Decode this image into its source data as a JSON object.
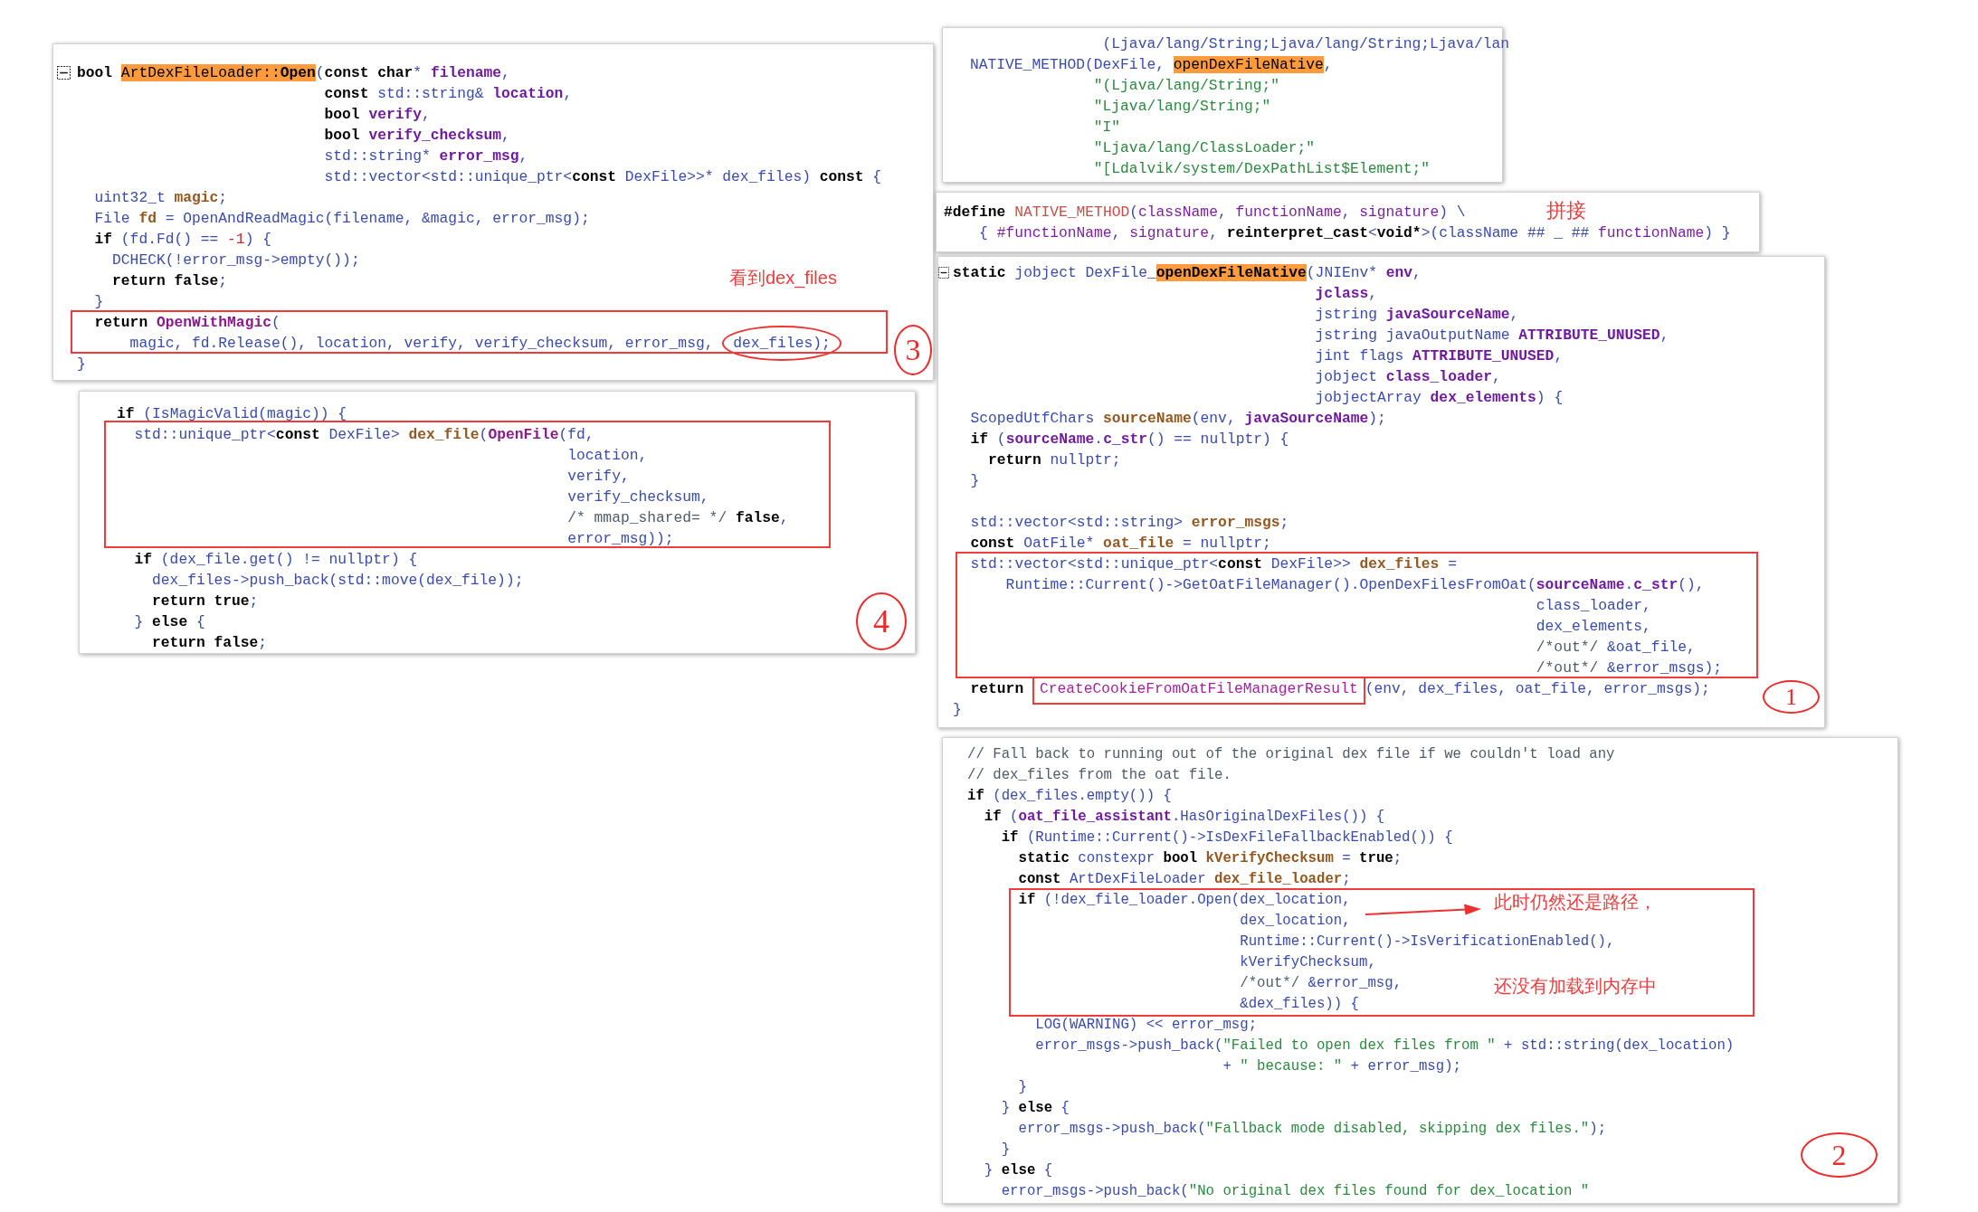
{
  "panels": [
    {
      "fold_marker": {
        "expanded": true
      },
      "lines": [
        {
          "kind": "code",
          "tokens": [
            {
              "kind": "kw",
              "text": "bool "
            },
            {
              "kind": "match",
              "text": "ArtDexFileLoader::"
            },
            {
              "kind": "matchb",
              "text": "Open"
            },
            {
              "kind": "plain",
              "text": "("
            },
            {
              "kind": "kw",
              "text": "const char"
            },
            {
              "kind": "plain",
              "text": "* "
            },
            {
              "kind": "param",
              "text": "filename"
            },
            {
              "kind": "plain",
              "text": ","
            }
          ]
        },
        {
          "kind": "code",
          "tokens": [
            {
              "kind": "kw",
              "text": "                            const"
            },
            {
              "kind": "plain",
              "text": " std::string& "
            },
            {
              "kind": "param",
              "text": "location"
            },
            {
              "kind": "plain",
              "text": ","
            }
          ]
        },
        {
          "kind": "code",
          "tokens": [
            {
              "kind": "kw",
              "text": "                            bool "
            },
            {
              "kind": "param",
              "text": "verify"
            },
            {
              "kind": "plain",
              "text": ","
            }
          ]
        },
        {
          "kind": "code",
          "tokens": [
            {
              "kind": "kw",
              "text": "                            bool "
            },
            {
              "kind": "param",
              "text": "verify_checksum"
            },
            {
              "kind": "plain",
              "text": ","
            }
          ]
        },
        {
          "kind": "code",
          "tokens": [
            {
              "kind": "plain",
              "text": "                            std::string* "
            },
            {
              "kind": "param",
              "text": "error_msg"
            },
            {
              "kind": "plain",
              "text": ","
            }
          ]
        },
        {
          "kind": "code",
          "tokens": [
            {
              "kind": "plain",
              "text": "                            std::vector<std::unique_ptr<"
            },
            {
              "kind": "kw",
              "text": "const"
            },
            {
              "kind": "plain",
              "text": " DexFile>>* dex_files) "
            },
            {
              "kind": "kw",
              "text": "const"
            },
            {
              "kind": "plain",
              "text": " {"
            }
          ]
        },
        {
          "kind": "code",
          "tokens": [
            {
              "kind": "plain",
              "text": "  uint32_t "
            },
            {
              "kind": "local",
              "text": "magic"
            },
            {
              "kind": "plain",
              "text": ";"
            }
          ]
        },
        {
          "kind": "code",
          "tokens": [
            {
              "kind": "plain",
              "text": "  File "
            },
            {
              "kind": "local",
              "text": "fd"
            },
            {
              "kind": "plain",
              "text": " = OpenAndReadMagic(filename, &magic, error_msg);"
            }
          ]
        },
        {
          "kind": "code",
          "tokens": [
            {
              "kind": "kw",
              "text": "  if"
            },
            {
              "kind": "plain",
              "text": " (fd.Fd() == "
            },
            {
              "kind": "num",
              "text": "-1"
            },
            {
              "kind": "plain",
              "text": ") {"
            }
          ]
        },
        {
          "kind": "code",
          "tokens": [
            {
              "kind": "plain",
              "text": "    DCHECK(!error_msg->empty());"
            }
          ]
        },
        {
          "kind": "code",
          "tokens": [
            {
              "kind": "kw",
              "text": "    return false"
            },
            {
              "kind": "plain",
              "text": ";"
            }
          ]
        },
        {
          "kind": "code",
          "tokens": [
            {
              "kind": "plain",
              "text": "  }"
            }
          ]
        },
        {
          "kind": "code",
          "tokens": [
            {
              "kind": "kw",
              "text": "  return "
            },
            {
              "kind": "func",
              "text": "OpenWithMagic"
            },
            {
              "kind": "plain",
              "text": "("
            }
          ]
        },
        {
          "kind": "split",
          "segments": [
            {
              "kind": "text",
              "tokens": [
                {
                  "kind": "plain",
                  "text": "      magic, fd.Release(), location, verify, verify_checksum, error_msg, "
                }
              ]
            },
            {
              "kind": "circled",
              "tokens": [
                {
                  "kind": "plain",
                  "text": "dex_files);"
                }
              ]
            }
          ]
        },
        {
          "kind": "code",
          "tokens": [
            {
              "kind": "plain",
              "text": "}"
            }
          ]
        }
      ],
      "annotations": [
        {
          "kind": "frame"
        },
        {
          "kind": "note",
          "text": "看到dex_files"
        },
        {
          "kind": "step",
          "text": "3"
        }
      ]
    },
    {
      "lines": [
        {
          "kind": "code",
          "tokens": [
            {
              "kind": "kw",
              "text": "if"
            },
            {
              "kind": "plain",
              "text": " (IsMagicValid(magic)) {"
            }
          ]
        },
        {
          "kind": "code",
          "tokens": [
            {
              "kind": "plain",
              "text": "  std::unique_ptr<"
            },
            {
              "kind": "kw",
              "text": "const"
            },
            {
              "kind": "plain",
              "text": " DexFile> "
            },
            {
              "kind": "local",
              "text": "dex_file"
            },
            {
              "kind": "plain",
              "text": "("
            },
            {
              "kind": "func",
              "text": "OpenFile"
            },
            {
              "kind": "plain",
              "text": "(fd,"
            }
          ]
        },
        {
          "kind": "code",
          "tokens": [
            {
              "kind": "plain",
              "text": "                                                   location,"
            }
          ]
        },
        {
          "kind": "code",
          "tokens": [
            {
              "kind": "plain",
              "text": "                                                   verify,"
            }
          ]
        },
        {
          "kind": "code",
          "tokens": [
            {
              "kind": "plain",
              "text": "                                                   verify_checksum,"
            }
          ]
        },
        {
          "kind": "code",
          "tokens": [
            {
              "kind": "cmt",
              "text": "                                                   /* mmap_shared= */ "
            },
            {
              "kind": "kw",
              "text": "false"
            },
            {
              "kind": "plain",
              "text": ","
            }
          ]
        },
        {
          "kind": "code",
          "tokens": [
            {
              "kind": "plain",
              "text": "                                                   error_msg));"
            }
          ]
        },
        {
          "kind": "code",
          "tokens": [
            {
              "kind": "kw",
              "text": "  if"
            },
            {
              "kind": "plain",
              "text": " (dex_file.get() != nullptr) {"
            }
          ]
        },
        {
          "kind": "code",
          "tokens": [
            {
              "kind": "plain",
              "text": "    dex_files->push_back(std::move(dex_file));"
            }
          ]
        },
        {
          "kind": "code",
          "tokens": [
            {
              "kind": "kw",
              "text": "    return true"
            },
            {
              "kind": "plain",
              "text": ";"
            }
          ]
        },
        {
          "kind": "code",
          "tokens": [
            {
              "kind": "plain",
              "text": "  } "
            },
            {
              "kind": "kw",
              "text": "else"
            },
            {
              "kind": "plain",
              "text": " {"
            }
          ]
        },
        {
          "kind": "code",
          "tokens": [
            {
              "kind": "kw",
              "text": "    return false"
            },
            {
              "kind": "plain",
              "text": ";"
            }
          ]
        }
      ],
      "annotations": [
        {
          "kind": "frame"
        },
        {
          "kind": "step",
          "text": "4"
        }
      ]
    },
    {
      "lines": [
        {
          "kind": "code",
          "tokens": [
            {
              "kind": "plain",
              "text": "               (Ljava/lang/String;Ljava/lang/String;Ljava/lan"
            }
          ]
        },
        {
          "kind": "code",
          "tokens": [
            {
              "kind": "plain",
              "text": "NATIVE_METHOD(DexFile, "
            },
            {
              "kind": "match",
              "text": "openDexFileNative"
            },
            {
              "kind": "plain",
              "text": ","
            }
          ]
        },
        {
          "kind": "code",
          "tokens": [
            {
              "kind": "str",
              "text": "              \"(Ljava/lang/String;\""
            }
          ]
        },
        {
          "kind": "code",
          "tokens": [
            {
              "kind": "str",
              "text": "              \"Ljava/lang/String;\""
            }
          ]
        },
        {
          "kind": "code",
          "tokens": [
            {
              "kind": "str",
              "text": "              \"I\""
            }
          ]
        },
        {
          "kind": "code",
          "tokens": [
            {
              "kind": "str",
              "text": "              \"Ljava/lang/ClassLoader;\""
            }
          ]
        },
        {
          "kind": "code",
          "tokens": [
            {
              "kind": "str",
              "text": "              \"[Ldalvik/system/DexPathList$Element;\""
            }
          ]
        }
      ]
    },
    {
      "lines": [
        {
          "kind": "code",
          "tokens": [
            {
              "kind": "kw",
              "text": "#define "
            },
            {
              "kind": "macro",
              "text": "NATIVE_METHOD"
            },
            {
              "kind": "plain",
              "text": "("
            },
            {
              "kind": "mparam",
              "text": "className"
            },
            {
              "kind": "plain",
              "text": ", "
            },
            {
              "kind": "mparam",
              "text": "functionName"
            },
            {
              "kind": "plain",
              "text": ", "
            },
            {
              "kind": "mparam",
              "text": "signature"
            },
            {
              "kind": "plain",
              "text": ") \\"
            }
          ]
        },
        {
          "kind": "code",
          "tokens": [
            {
              "kind": "plain",
              "text": "    { "
            },
            {
              "kind": "mparam",
              "text": "#functionName"
            },
            {
              "kind": "plain",
              "text": ", "
            },
            {
              "kind": "mparam",
              "text": "signature"
            },
            {
              "kind": "plain",
              "text": ", "
            },
            {
              "kind": "kw",
              "text": "reinterpret_cast"
            },
            {
              "kind": "plain",
              "text": "<"
            },
            {
              "kind": "kw",
              "text": "void*"
            },
            {
              "kind": "plain",
              "text": ">(className ## _ ## "
            },
            {
              "kind": "mparam",
              "text": "functionName"
            },
            {
              "kind": "plain",
              "text": ") }"
            }
          ]
        }
      ],
      "annotations": [
        {
          "kind": "note",
          "text": "拼接"
        }
      ]
    },
    {
      "fold_marker": {
        "expanded": true
      },
      "lines": [
        {
          "kind": "code",
          "tokens": [
            {
              "kind": "kw",
              "text": "static"
            },
            {
              "kind": "plain",
              "text": " jobject DexFile_"
            },
            {
              "kind": "matchb",
              "text": "openDexFileNative"
            },
            {
              "kind": "plain",
              "text": "(JNIEnv* "
            },
            {
              "kind": "param",
              "text": "env"
            },
            {
              "kind": "plain",
              "text": ","
            }
          ]
        },
        {
          "kind": "code",
          "tokens": [
            {
              "kind": "param",
              "text": "                                         jclass"
            },
            {
              "kind": "plain",
              "text": ","
            }
          ]
        },
        {
          "kind": "code",
          "tokens": [
            {
              "kind": "plain",
              "text": "                                         jstring "
            },
            {
              "kind": "param",
              "text": "javaSourceName"
            },
            {
              "kind": "plain",
              "text": ","
            }
          ]
        },
        {
          "kind": "code",
          "tokens": [
            {
              "kind": "plain",
              "text": "                                         jstring javaOutputName "
            },
            {
              "kind": "param",
              "text": "ATTRIBUTE_UNUSED"
            },
            {
              "kind": "plain",
              "text": ","
            }
          ]
        },
        {
          "kind": "code",
          "tokens": [
            {
              "kind": "plain",
              "text": "                                         jint flags "
            },
            {
              "kind": "param",
              "text": "ATTRIBUTE_UNUSED"
            },
            {
              "kind": "plain",
              "text": ","
            }
          ]
        },
        {
          "kind": "code",
          "tokens": [
            {
              "kind": "plain",
              "text": "                                         jobject "
            },
            {
              "kind": "param",
              "text": "class_loader"
            },
            {
              "kind": "plain",
              "text": ","
            }
          ]
        },
        {
          "kind": "code",
          "tokens": [
            {
              "kind": "plain",
              "text": "                                         jobjectArray "
            },
            {
              "kind": "param",
              "text": "dex_elements"
            },
            {
              "kind": "plain",
              "text": ") {"
            }
          ]
        },
        {
          "kind": "code",
          "tokens": [
            {
              "kind": "plain",
              "text": "  ScopedUtfChars "
            },
            {
              "kind": "local",
              "text": "sourceName"
            },
            {
              "kind": "plain",
              "text": "(env, "
            },
            {
              "kind": "param",
              "text": "javaSourceName"
            },
            {
              "kind": "plain",
              "text": ");"
            }
          ]
        },
        {
          "kind": "code",
          "tokens": [
            {
              "kind": "kw",
              "text": "  if"
            },
            {
              "kind": "plain",
              "text": " ("
            },
            {
              "kind": "param",
              "text": "sourceName"
            },
            {
              "kind": "plain",
              "text": "."
            },
            {
              "kind": "param",
              "text": "c_str"
            },
            {
              "kind": "plain",
              "text": "() == nullptr) {"
            }
          ]
        },
        {
          "kind": "code",
          "tokens": [
            {
              "kind": "kw",
              "text": "    return"
            },
            {
              "kind": "plain",
              "text": " nullptr;"
            }
          ]
        },
        {
          "kind": "code",
          "tokens": [
            {
              "kind": "plain",
              "text": "  }"
            }
          ]
        },
        {
          "kind": "blank"
        },
        {
          "kind": "code",
          "tokens": [
            {
              "kind": "plain",
              "text": "  std::vector<std::string> "
            },
            {
              "kind": "local",
              "text": "error_msgs"
            },
            {
              "kind": "plain",
              "text": ";"
            }
          ]
        },
        {
          "kind": "code",
          "tokens": [
            {
              "kind": "kw",
              "text": "  const"
            },
            {
              "kind": "plain",
              "text": " OatFile* "
            },
            {
              "kind": "local",
              "text": "oat_file"
            },
            {
              "kind": "plain",
              "text": " = nullptr;"
            }
          ]
        },
        {
          "kind": "code",
          "tokens": [
            {
              "kind": "plain",
              "text": "  std::vector<std::unique_ptr<"
            },
            {
              "kind": "kw",
              "text": "const"
            },
            {
              "kind": "plain",
              "text": " DexFile>> "
            },
            {
              "kind": "local",
              "text": "dex_files"
            },
            {
              "kind": "plain",
              "text": " ="
            }
          ]
        },
        {
          "kind": "code",
          "tokens": [
            {
              "kind": "plain",
              "text": "      Runtime::Current()->GetOatFileManager().OpenDexFilesFromOat("
            },
            {
              "kind": "param",
              "text": "sourceName"
            },
            {
              "kind": "plain",
              "text": "."
            },
            {
              "kind": "param",
              "text": "c_str"
            },
            {
              "kind": "plain",
              "text": "(),"
            }
          ]
        },
        {
          "kind": "code",
          "tokens": [
            {
              "kind": "plain",
              "text": "                                                                  class_loader,"
            }
          ]
        },
        {
          "kind": "code",
          "tokens": [
            {
              "kind": "plain",
              "text": "                                                                  dex_elements,"
            }
          ]
        },
        {
          "kind": "code",
          "tokens": [
            {
              "kind": "cmt",
              "text": "                                                                  /*out*/"
            },
            {
              "kind": "plain",
              "text": " &oat_file,"
            }
          ]
        },
        {
          "kind": "code",
          "tokens": [
            {
              "kind": "cmt",
              "text": "                                                                  /*out*/"
            },
            {
              "kind": "plain",
              "text": " &error_msgs);"
            }
          ]
        },
        {
          "kind": "split",
          "segments": [
            {
              "kind": "text",
              "tokens": [
                {
                  "kind": "kw",
                  "text": "  return "
                }
              ]
            },
            {
              "kind": "boxed",
              "tokens": [
                {
                  "kind": "call",
                  "text": "CreateCookieFromOatFileManagerResult"
                }
              ]
            },
            {
              "kind": "text",
              "tokens": [
                {
                  "kind": "plain",
                  "text": "(env, dex_files, oat_file, error_msgs);"
                }
              ]
            }
          ]
        },
        {
          "kind": "code",
          "tokens": [
            {
              "kind": "plain",
              "text": "}"
            }
          ]
        }
      ],
      "annotations": [
        {
          "kind": "frame"
        },
        {
          "kind": "step",
          "text": "1"
        }
      ]
    },
    {
      "lines": [
        {
          "kind": "code",
          "tokens": [
            {
              "kind": "cmt",
              "text": "// Fall back to running out of the original dex file if we couldn't load any"
            }
          ]
        },
        {
          "kind": "code",
          "tokens": [
            {
              "kind": "cmt",
              "text": "// dex_files from the oat file."
            }
          ]
        },
        {
          "kind": "code",
          "tokens": [
            {
              "kind": "kw",
              "text": "if"
            },
            {
              "kind": "plain",
              "text": " (dex_files.empty()) {"
            }
          ]
        },
        {
          "kind": "code",
          "tokens": [
            {
              "kind": "kw",
              "text": "  if"
            },
            {
              "kind": "plain",
              "text": " ("
            },
            {
              "kind": "param",
              "text": "oat_file_assistant"
            },
            {
              "kind": "plain",
              "text": ".HasOriginalDexFiles()) {"
            }
          ]
        },
        {
          "kind": "code",
          "tokens": [
            {
              "kind": "kw",
              "text": "    if"
            },
            {
              "kind": "plain",
              "text": " (Runtime::Current()->IsDexFileFallbackEnabled()) {"
            }
          ]
        },
        {
          "kind": "code",
          "tokens": [
            {
              "kind": "kw",
              "text": "      static"
            },
            {
              "kind": "plain",
              "text": " constexpr "
            },
            {
              "kind": "kw",
              "text": "bool "
            },
            {
              "kind": "local",
              "text": "kVerifyChecksum"
            },
            {
              "kind": "plain",
              "text": " = "
            },
            {
              "kind": "kw",
              "text": "true"
            },
            {
              "kind": "plain",
              "text": ";"
            }
          ]
        },
        {
          "kind": "code",
          "tokens": [
            {
              "kind": "kw",
              "text": "      const"
            },
            {
              "kind": "plain",
              "text": " ArtDexFileLoader "
            },
            {
              "kind": "local",
              "text": "dex_file_loader"
            },
            {
              "kind": "plain",
              "text": ";"
            }
          ]
        },
        {
          "kind": "code",
          "tokens": [
            {
              "kind": "kw",
              "text": "      if"
            },
            {
              "kind": "plain",
              "text": " (!dex_file_loader.Open(dex_location,"
            }
          ]
        },
        {
          "kind": "code",
          "tokens": [
            {
              "kind": "plain",
              "text": "                                dex_location,"
            }
          ]
        },
        {
          "kind": "code",
          "tokens": [
            {
              "kind": "plain",
              "text": "                                Runtime::Current()->IsVerificationEnabled(),"
            }
          ]
        },
        {
          "kind": "code",
          "tokens": [
            {
              "kind": "plain",
              "text": "                                kVerifyChecksum,"
            }
          ]
        },
        {
          "kind": "code",
          "tokens": [
            {
              "kind": "cmt",
              "text": "                                /*out*/"
            },
            {
              "kind": "plain",
              "text": " &error_msg,"
            }
          ]
        },
        {
          "kind": "code",
          "tokens": [
            {
              "kind": "plain",
              "text": "                                &dex_files)) {"
            }
          ]
        },
        {
          "kind": "code",
          "tokens": [
            {
              "kind": "plain",
              "text": "        LOG(WARNING) << error_msg;"
            }
          ]
        },
        {
          "kind": "code",
          "tokens": [
            {
              "kind": "plain",
              "text": "        error_msgs->push_back("
            },
            {
              "kind": "str",
              "text": "\"Failed to open dex files from \""
            },
            {
              "kind": "plain",
              "text": " + std::string(dex_location)"
            }
          ]
        },
        {
          "kind": "code",
          "tokens": [
            {
              "kind": "plain",
              "text": "                              + "
            },
            {
              "kind": "str",
              "text": "\" because: \""
            },
            {
              "kind": "plain",
              "text": " + error_msg);"
            }
          ]
        },
        {
          "kind": "code",
          "tokens": [
            {
              "kind": "plain",
              "text": "      }"
            }
          ]
        },
        {
          "kind": "code",
          "tokens": [
            {
              "kind": "plain",
              "text": "    } "
            },
            {
              "kind": "kw",
              "text": "else"
            },
            {
              "kind": "plain",
              "text": " {"
            }
          ]
        },
        {
          "kind": "code",
          "tokens": [
            {
              "kind": "plain",
              "text": "      error_msgs->push_back("
            },
            {
              "kind": "str",
              "text": "\"Fallback mode disabled, skipping dex files.\""
            },
            {
              "kind": "plain",
              "text": ");"
            }
          ]
        },
        {
          "kind": "code",
          "tokens": [
            {
              "kind": "plain",
              "text": "    }"
            }
          ]
        },
        {
          "kind": "code",
          "tokens": [
            {
              "kind": "plain",
              "text": "  } "
            },
            {
              "kind": "kw",
              "text": "else"
            },
            {
              "kind": "plain",
              "text": " {"
            }
          ]
        },
        {
          "kind": "code",
          "tokens": [
            {
              "kind": "plain",
              "text": "    error_msgs->push_back("
            },
            {
              "kind": "str",
              "text": "\"No original dex files found for dex_location \""
            }
          ]
        }
      ],
      "annotations": [
        {
          "kind": "frame"
        },
        {
          "kind": "arrow"
        },
        {
          "kind": "note",
          "text": "此时仍然还是路径，"
        },
        {
          "kind": "note",
          "text": "还没有加载到内存中"
        },
        {
          "kind": "step",
          "text": "2"
        }
      ]
    }
  ]
}
